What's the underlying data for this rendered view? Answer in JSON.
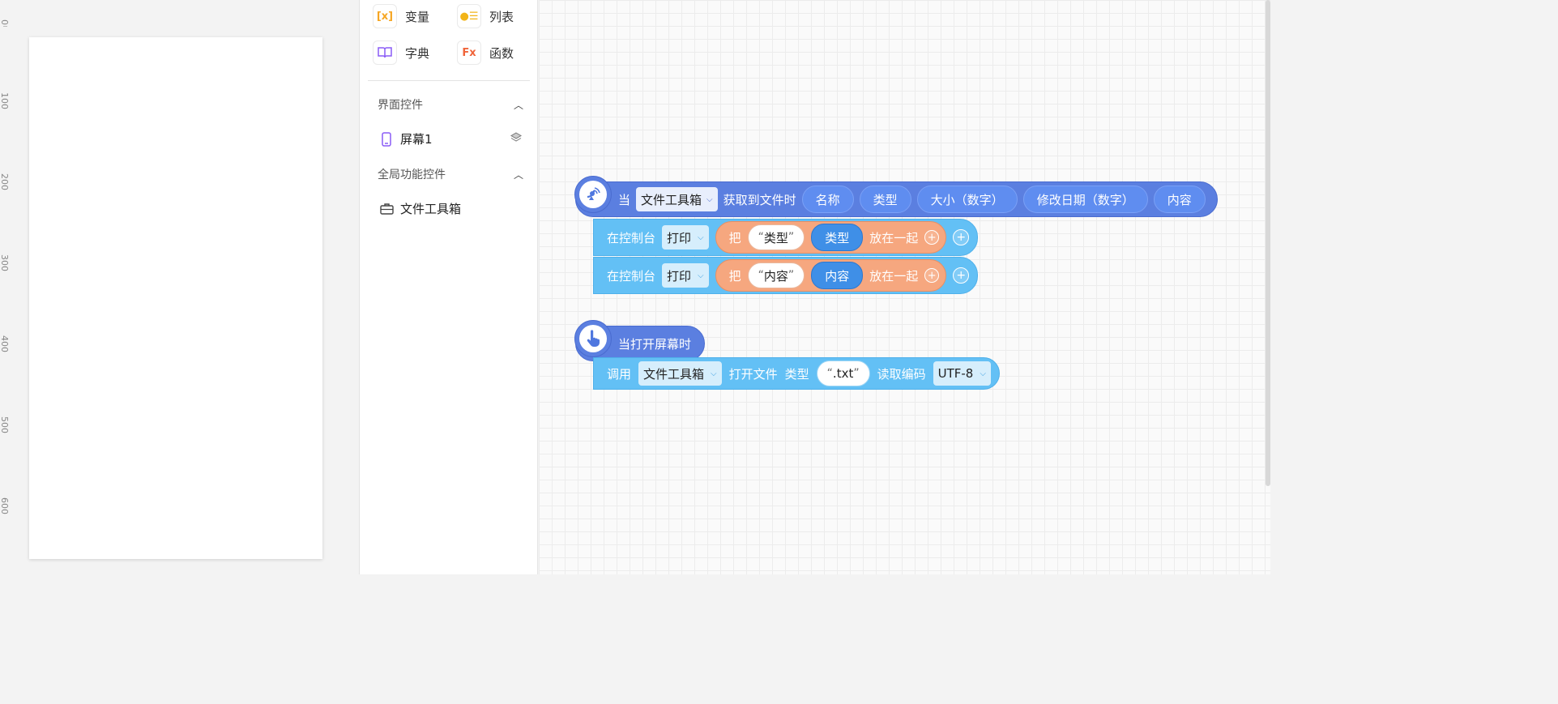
{
  "ruler": {
    "ticks": [
      "0",
      "100",
      "200",
      "300",
      "400",
      "500",
      "600"
    ]
  },
  "palette": {
    "tools": [
      {
        "label": "变量",
        "icon": "variable-icon",
        "glyph": "[x]",
        "color": "#f6a623"
      },
      {
        "label": "列表",
        "icon": "list-icon",
        "glyph": "●☰",
        "color": "#f2b418"
      },
      {
        "label": "字典",
        "icon": "book-icon",
        "glyph": "📖",
        "color": "#8a5cf6"
      },
      {
        "label": "函数",
        "icon": "function-icon",
        "glyph": "Fx",
        "color": "#f0643a"
      }
    ],
    "section_ui": "界面控件",
    "screen_item": "屏幕1",
    "section_global": "全局功能控件",
    "global_item": "文件工具箱"
  },
  "canvas": {
    "event1": {
      "when": "当",
      "component": "文件工具箱",
      "event": "获取到文件时",
      "params": [
        "名称",
        "类型",
        "大小（数字）",
        "修改日期（数字）",
        "内容"
      ]
    },
    "statements": [
      {
        "prefix": "在控制台",
        "action": "打印",
        "join_label": "把",
        "string": "类型",
        "var": "类型",
        "suffix": "放在一起"
      },
      {
        "prefix": "在控制台",
        "action": "打印",
        "join_label": "把",
        "string": "内容",
        "var": "内容",
        "suffix": "放在一起"
      }
    ],
    "event2": {
      "label": "当打开屏幕时"
    },
    "call": {
      "verb": "调用",
      "component": "文件工具箱",
      "method": "打开文件",
      "type_label": "类型",
      "type_value": ".txt",
      "encoding_label": "读取编码",
      "encoding_value": "UTF-8"
    }
  }
}
